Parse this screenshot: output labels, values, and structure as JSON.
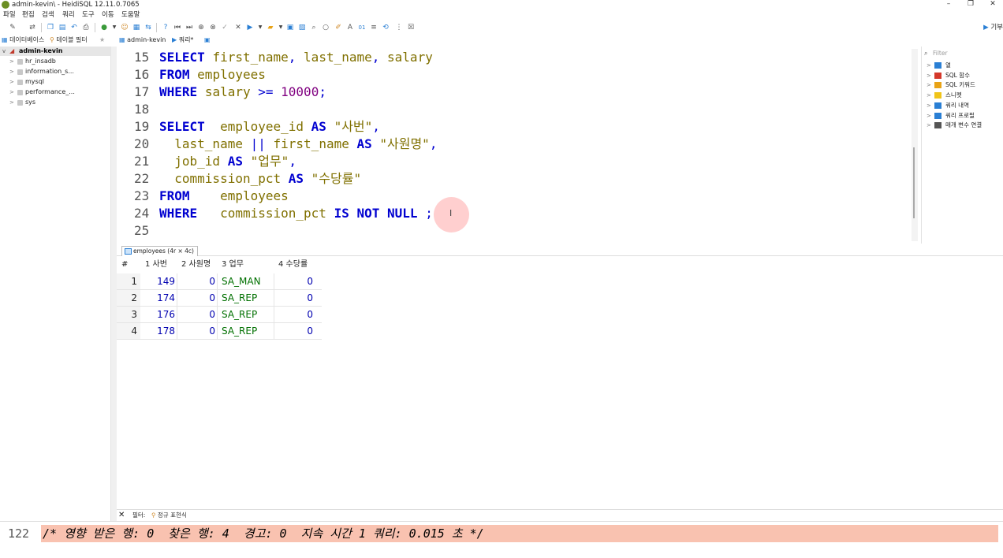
{
  "window": {
    "title": "admin-kevin\\ - HeidiSQL 12.11.0.7065",
    "min_glyph": "–",
    "max_glyph": "❐",
    "close_glyph": "✕"
  },
  "menu": [
    "파일",
    "편집",
    "검색",
    "쿼리",
    "도구",
    "이동",
    "도움말"
  ],
  "toolbar": {
    "help_label": "기부"
  },
  "left_tabs": {
    "database": "데이터베이스",
    "table_filter": "테이블 필터"
  },
  "query_tabs": {
    "session": "admin-kevin",
    "query": "쿼리*"
  },
  "tree": {
    "root": "admin-kevin",
    "databases": [
      "hr_insadb",
      "information_s...",
      "mysql",
      "performance_...",
      "sys"
    ]
  },
  "editor": {
    "lines": [
      {
        "n": "15",
        "tokens": [
          [
            "kw",
            "SELECT"
          ],
          [
            "sp",
            " "
          ],
          [
            "id",
            "first_name"
          ],
          [
            "op",
            ","
          ],
          [
            "sp",
            " "
          ],
          [
            "id",
            "last_name"
          ],
          [
            "op",
            ","
          ],
          [
            "sp",
            " "
          ],
          [
            "id",
            "salary"
          ]
        ]
      },
      {
        "n": "16",
        "tokens": [
          [
            "kw",
            "FROM"
          ],
          [
            "sp",
            " "
          ],
          [
            "id",
            "employees"
          ]
        ]
      },
      {
        "n": "17",
        "tokens": [
          [
            "kw",
            "WHERE"
          ],
          [
            "sp",
            " "
          ],
          [
            "id",
            "salary"
          ],
          [
            "sp",
            " "
          ],
          [
            "op",
            ">="
          ],
          [
            "sp",
            " "
          ],
          [
            "num",
            "10000"
          ],
          [
            "op",
            ";"
          ]
        ]
      },
      {
        "n": "18",
        "tokens": []
      },
      {
        "n": "19",
        "tokens": [
          [
            "kw",
            "SELECT"
          ],
          [
            "sp",
            "  "
          ],
          [
            "id",
            "employee_id"
          ],
          [
            "sp",
            " "
          ],
          [
            "kw",
            "AS"
          ],
          [
            "sp",
            " "
          ],
          [
            "str",
            "\"사번\""
          ],
          [
            "op",
            ","
          ]
        ]
      },
      {
        "n": "20",
        "tokens": [
          [
            "sp",
            "  "
          ],
          [
            "id",
            "last_name"
          ],
          [
            "sp",
            " "
          ],
          [
            "op",
            "||"
          ],
          [
            "sp",
            " "
          ],
          [
            "id",
            "first_name"
          ],
          [
            "sp",
            " "
          ],
          [
            "kw",
            "AS"
          ],
          [
            "sp",
            " "
          ],
          [
            "str",
            "\"사원명\""
          ],
          [
            "op",
            ","
          ]
        ]
      },
      {
        "n": "21",
        "tokens": [
          [
            "sp",
            "  "
          ],
          [
            "id",
            "job_id"
          ],
          [
            "sp",
            " "
          ],
          [
            "kw",
            "AS"
          ],
          [
            "sp",
            " "
          ],
          [
            "str",
            "\"업무\""
          ],
          [
            "op",
            ","
          ]
        ]
      },
      {
        "n": "22",
        "tokens": [
          [
            "sp",
            "  "
          ],
          [
            "id",
            "commission_pct"
          ],
          [
            "sp",
            " "
          ],
          [
            "kw",
            "AS"
          ],
          [
            "sp",
            " "
          ],
          [
            "str",
            "\"수당률\""
          ]
        ]
      },
      {
        "n": "23",
        "tokens": [
          [
            "kw",
            "FROM"
          ],
          [
            "sp",
            "    "
          ],
          [
            "id",
            "employees"
          ]
        ]
      },
      {
        "n": "24",
        "tokens": [
          [
            "kw",
            "WHERE"
          ],
          [
            "sp",
            "   "
          ],
          [
            "id",
            "commission_pct"
          ],
          [
            "sp",
            " "
          ],
          [
            "kw",
            "IS"
          ],
          [
            "sp",
            " "
          ],
          [
            "kw",
            "NOT"
          ],
          [
            "sp",
            " "
          ],
          [
            "kw",
            "NULL"
          ],
          [
            "sp",
            " "
          ],
          [
            "op",
            ";"
          ]
        ]
      },
      {
        "n": "25",
        "tokens": []
      }
    ]
  },
  "right_panel": {
    "filter_placeholder": "Filter",
    "items": [
      {
        "label": "열",
        "icon": "columns-icon",
        "color": "#2a7fd4"
      },
      {
        "label": "SQL 함수",
        "icon": "function-icon",
        "color": "#d4382a"
      },
      {
        "label": "SQL 키워드",
        "icon": "keyword-icon",
        "color": "#e8a317"
      },
      {
        "label": "스니펫",
        "icon": "folder-icon",
        "color": "#f0c419"
      },
      {
        "label": "쿼리 내역",
        "icon": "history-icon",
        "color": "#2a7fd4"
      },
      {
        "label": "쿼리 프로필",
        "icon": "profile-icon",
        "color": "#2a7fd4"
      },
      {
        "label": "매개 변수 연결",
        "icon": "bind-params-icon",
        "color": "#555555"
      }
    ]
  },
  "results": {
    "tab_label": "employees (4r × 4c)",
    "columns": [
      "#",
      "1 사번",
      "2 사원명",
      "3 업무",
      "4 수당률"
    ],
    "rows": [
      [
        "1",
        "149",
        "0",
        "SA_MAN",
        "0"
      ],
      [
        "2",
        "174",
        "0",
        "SA_REP",
        "0"
      ],
      [
        "3",
        "176",
        "0",
        "SA_REP",
        "0"
      ],
      [
        "4",
        "178",
        "0",
        "SA_REP",
        "0"
      ]
    ]
  },
  "filter_bar": {
    "close_glyph": "✕",
    "label": "필터:",
    "regex_label": "정규 표현식"
  },
  "log": {
    "line_number": "122",
    "text": "/* 영향 받은 행: 0  찾은 행: 4  경고: 0  지속 시간 1 쿼리: 0.015 초 */"
  }
}
